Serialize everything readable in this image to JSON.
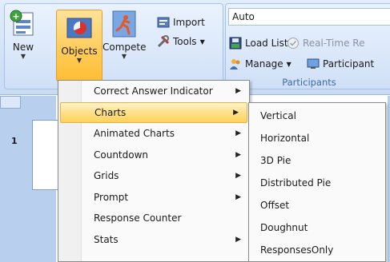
{
  "ribbon": {
    "buttons": {
      "new_label": "New",
      "objects_label": "Objects",
      "compete_label": "Compete"
    },
    "small": {
      "import_label": "Import",
      "tools_label": "Tools",
      "auto_value": "Auto",
      "load_list_label": "Load List",
      "realtime_label": "Real-Time Re",
      "manage_label": "Manage",
      "participant_label": "Participant",
      "participants_group_title": "Participants"
    }
  },
  "slide_pane": {
    "slide_number": "1"
  },
  "objects_menu": {
    "items": [
      {
        "label": "Correct Answer Indicator",
        "submenu": true
      },
      {
        "label": "Charts",
        "submenu": true,
        "highlighted": true
      },
      {
        "label": "Animated Charts",
        "submenu": true
      },
      {
        "label": "Countdown",
        "submenu": true
      },
      {
        "label": "Grids",
        "submenu": true
      },
      {
        "label": "Prompt",
        "submenu": true
      },
      {
        "label": "Response Counter",
        "submenu": false
      },
      {
        "label": "Stats",
        "submenu": true
      }
    ]
  },
  "charts_submenu": {
    "items": [
      {
        "label": "Vertical"
      },
      {
        "label": "Horizontal"
      },
      {
        "label": "3D Pie"
      },
      {
        "label": "Distributed Pie"
      },
      {
        "label": "Offset"
      },
      {
        "label": "Doughnut"
      },
      {
        "label": "ResponsesOnly"
      }
    ]
  },
  "colors": {
    "highlight": "#ffd25a",
    "ribbon_bg": "#d3e3f8",
    "group_title": "#3e6aa8"
  },
  "icons": {
    "new": "new-document-icon",
    "objects": "objects-pie-icon",
    "compete": "runner-icon",
    "import": "import-icon",
    "tools": "tools-icon",
    "load_list": "save-disk-icon",
    "realtime": "checkmark-circle-icon",
    "manage": "people-icon",
    "participant": "monitor-icon"
  }
}
